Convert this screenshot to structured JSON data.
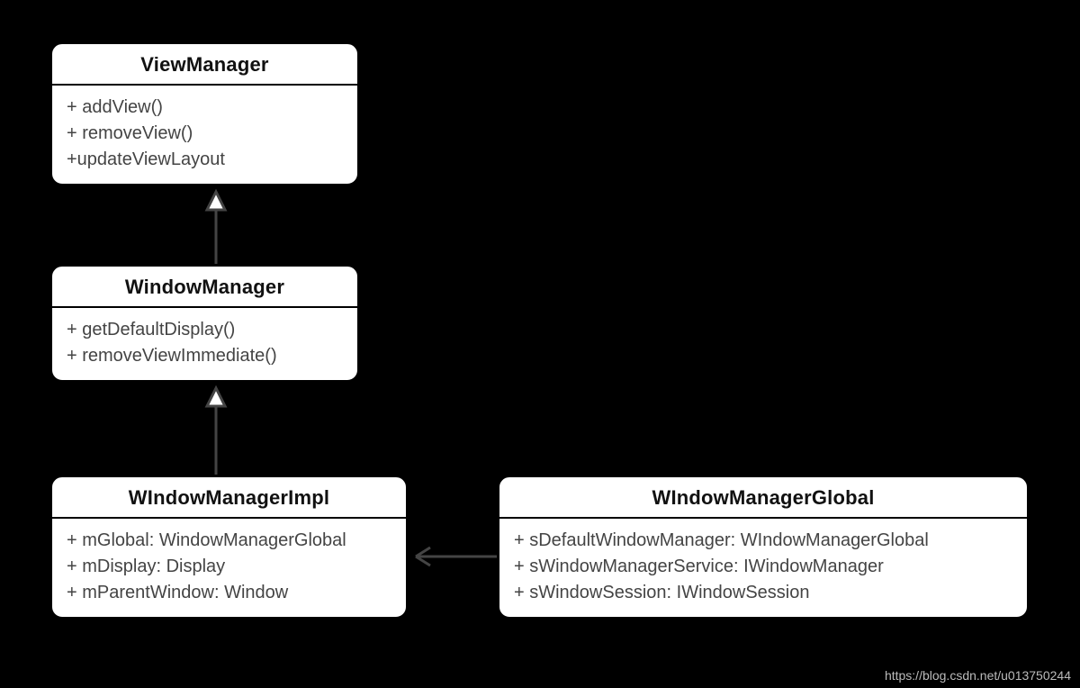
{
  "boxes": {
    "viewManager": {
      "title": "ViewManager",
      "members": [
        "+ addView()",
        "+ removeView()",
        "+updateViewLayout"
      ]
    },
    "windowManager": {
      "title": "WindowManager",
      "members": [
        "+ getDefaultDisplay()",
        "+ removeViewImmediate()"
      ]
    },
    "windowManagerImpl": {
      "title": "WIndowManagerImpl",
      "members": [
        "+ mGlobal: WindowManagerGlobal",
        "+ mDisplay: Display",
        "+ mParentWindow: Window"
      ]
    },
    "windowManagerGlobal": {
      "title": "WIndowManagerGlobal",
      "members": [
        "+ sDefaultWindowManager: WIndowManagerGlobal",
        "+ sWindowManagerService: IWindowManager",
        "+ sWindowSession: IWindowSession"
      ]
    }
  },
  "watermark": "https://blog.csdn.net/u013750244"
}
